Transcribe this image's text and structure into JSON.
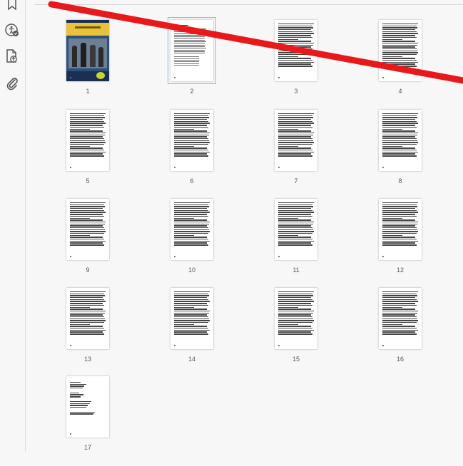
{
  "sidebar": {
    "icons": [
      {
        "name": "bookmark-icon"
      },
      {
        "name": "accessibility-check-icon"
      },
      {
        "name": "page-attach-icon"
      },
      {
        "name": "paperclip-icon"
      }
    ]
  },
  "thumbnails": {
    "selected_page": "2",
    "pages": [
      {
        "num": "1",
        "kind": "cover"
      },
      {
        "num": "2",
        "kind": "toc"
      },
      {
        "num": "3",
        "kind": "text"
      },
      {
        "num": "4",
        "kind": "text"
      },
      {
        "num": "5",
        "kind": "text"
      },
      {
        "num": "6",
        "kind": "text"
      },
      {
        "num": "7",
        "kind": "text"
      },
      {
        "num": "8",
        "kind": "text"
      },
      {
        "num": "9",
        "kind": "text"
      },
      {
        "num": "10",
        "kind": "text"
      },
      {
        "num": "11",
        "kind": "text"
      },
      {
        "num": "12",
        "kind": "text"
      },
      {
        "num": "13",
        "kind": "text"
      },
      {
        "num": "14",
        "kind": "text"
      },
      {
        "num": "15",
        "kind": "text"
      },
      {
        "num": "16",
        "kind": "text"
      },
      {
        "num": "17",
        "kind": "contact"
      }
    ]
  },
  "annotation": {
    "color": "#e8191b"
  }
}
